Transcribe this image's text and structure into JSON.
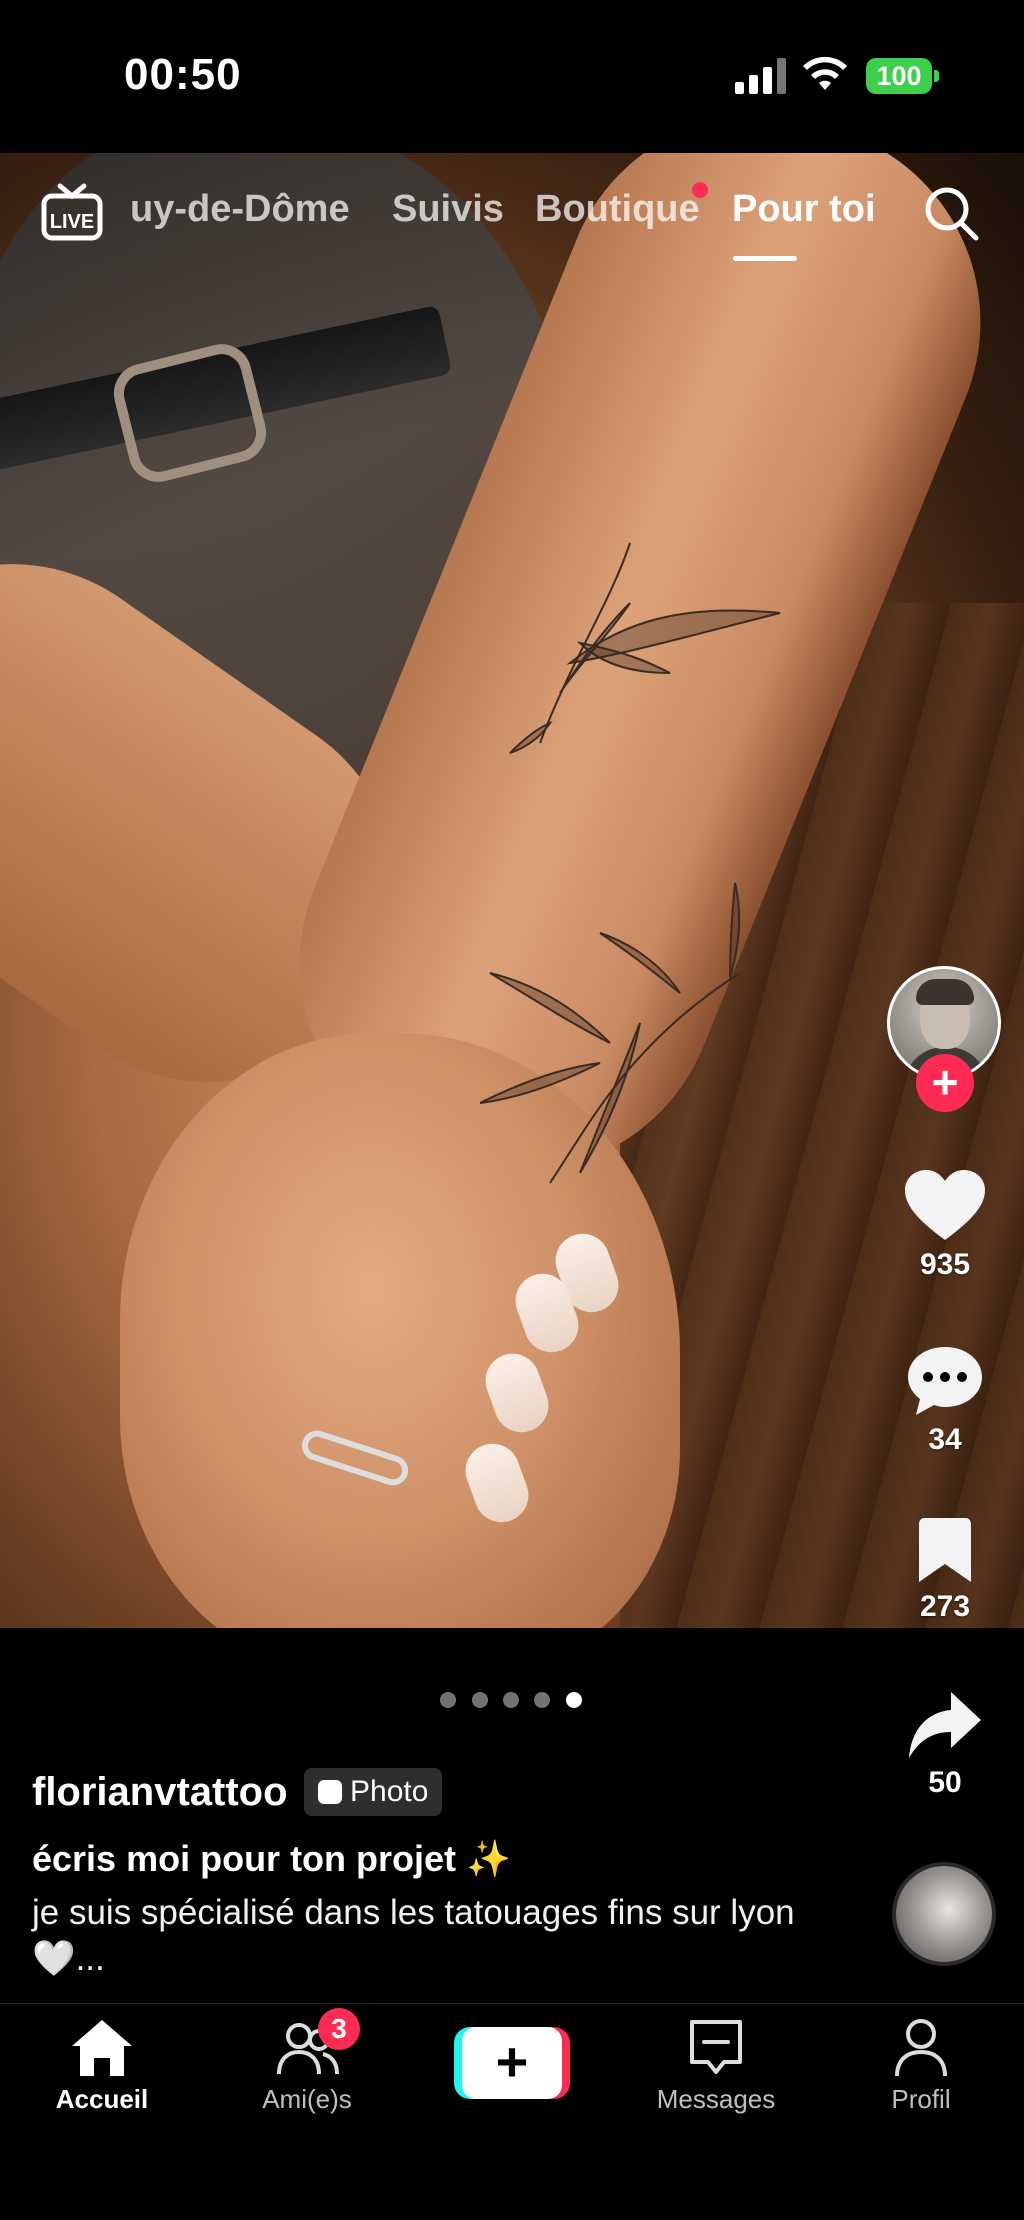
{
  "status_bar": {
    "time": "00:50",
    "battery": "100",
    "battery_color": "#3ecf4c"
  },
  "top_nav": {
    "live_icon": "live-tv-icon",
    "tabs": [
      {
        "label": "uy-de-Dôme"
      },
      {
        "label": "Suivis"
      },
      {
        "label": "Boutique"
      },
      {
        "label": "Pour toi"
      }
    ],
    "active_tab": "Pour toi",
    "search_icon": "search-icon"
  },
  "actions": {
    "likes": "935",
    "comments": "34",
    "saves": "273",
    "shares": "50",
    "follow_color": "#fe2c55"
  },
  "carousel": {
    "total": 5,
    "active_index": 4
  },
  "caption": {
    "author": "florianvtattoo",
    "badge": "Photo",
    "title": "écris moi pour ton projet ✨",
    "description": "je suis spécialisé dans les tatouages fins sur lyon 🤍..."
  },
  "bottom_nav": {
    "items": [
      {
        "label": "Accueil"
      },
      {
        "label": "Ami(e)s"
      },
      {
        "label": "Messages"
      },
      {
        "label": "Profil"
      }
    ],
    "friends_badge": "3",
    "create_label": "+"
  }
}
